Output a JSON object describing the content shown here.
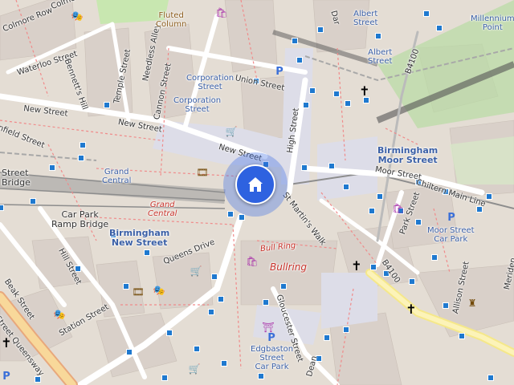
{
  "map": {
    "streets": [
      {
        "id": "colmore-row",
        "text": "Colmore Row",
        "color": "dark"
      },
      {
        "id": "colmore",
        "text": "Colmo",
        "color": "dark"
      },
      {
        "id": "waterloo",
        "text": "Waterloo Street",
        "color": "dark"
      },
      {
        "id": "bennetts",
        "text": "Bennett's Hill",
        "color": "dark"
      },
      {
        "id": "temple",
        "text": "Temple Street",
        "color": "dark"
      },
      {
        "id": "needless",
        "text": "Needless Alley",
        "color": "dark"
      },
      {
        "id": "cannon",
        "text": "Cannon Street",
        "color": "dark"
      },
      {
        "id": "new-street-1",
        "text": "New Street",
        "color": "dark"
      },
      {
        "id": "new-street-2",
        "text": "New Street",
        "color": "dark"
      },
      {
        "id": "new-street-3",
        "text": "New Street",
        "color": "dark"
      },
      {
        "id": "union",
        "text": "Union Street",
        "color": "dark"
      },
      {
        "id": "high",
        "text": "High Street",
        "color": "dark"
      },
      {
        "id": "stmartins",
        "text": "St Martin's Walk",
        "color": "dark"
      },
      {
        "id": "moor",
        "text": "Moor Street",
        "color": "dark"
      },
      {
        "id": "park",
        "text": "Park Street",
        "color": "dark"
      },
      {
        "id": "queens",
        "text": "Queens Drive",
        "color": "dark"
      },
      {
        "id": "hill",
        "text": "Hill Street",
        "color": "dark"
      },
      {
        "id": "beak",
        "text": "Beak Street",
        "color": "dark"
      },
      {
        "id": "station",
        "text": "Station Street",
        "color": "dark"
      },
      {
        "id": "gloucester",
        "text": "Gloucester Street",
        "color": "dark"
      },
      {
        "id": "allison",
        "text": "Allison Street",
        "color": "dark"
      },
      {
        "id": "meriden",
        "text": "Meriden",
        "color": "dark"
      },
      {
        "id": "smallbrook",
        "text": "Street Queensway",
        "color": "dark"
      },
      {
        "id": "chiltern",
        "text": "Chiltern Main Line",
        "color": "dark"
      },
      {
        "id": "nfield",
        "text": "nfield Street",
        "color": "dark"
      },
      {
        "id": "dean",
        "text": "Dean",
        "color": "dark"
      },
      {
        "id": "dar",
        "text": "Dar",
        "color": "dark"
      },
      {
        "id": "b4100a",
        "text": "B4100",
        "color": "dark"
      },
      {
        "id": "b4100b",
        "text": "B4100",
        "color": "dark"
      }
    ],
    "places": [
      {
        "id": "albert-street-1",
        "text": "Albert\nStreet"
      },
      {
        "id": "albert-street-2",
        "text": "Albert\nStreet"
      },
      {
        "id": "corporation-1",
        "text": "Corporation\nStreet"
      },
      {
        "id": "corporation-2",
        "text": "Corporation\nStreet"
      },
      {
        "id": "grand-central",
        "text": "Grand\nCentral"
      },
      {
        "id": "car-park-ramp",
        "text": "Car Park\nRamp Bridge"
      },
      {
        "id": "moor-car-park",
        "text": "Moor Street\nCar Park"
      },
      {
        "id": "edgbaston",
        "text": "Edgbaston\nStreet\nCar Park"
      },
      {
        "id": "millennium",
        "text": "Millennium\nPoint"
      },
      {
        "id": "fluted",
        "text": "Fluted\nColumn"
      },
      {
        "id": "street-bridge",
        "text": "Street\nBridge"
      }
    ],
    "stations": [
      {
        "id": "bham-new-street",
        "text": "Birmingham\nNew Street"
      },
      {
        "id": "bham-moor-street",
        "text": "Birmingham\nMoor Street"
      }
    ],
    "red_labels": [
      {
        "id": "grand-central-red",
        "text": "Grand\nCentral"
      },
      {
        "id": "bull-ring-small",
        "text": "Bull Ring"
      },
      {
        "id": "bullring-big",
        "text": "Bullring"
      }
    ],
    "icons": [
      {
        "name": "theatre-icon",
        "glyph": "🎭",
        "color": "brown"
      },
      {
        "name": "shop-bag-icon",
        "glyph": "🛍",
        "color": "purple"
      },
      {
        "name": "shop-bag-icon-2",
        "glyph": "🛍",
        "color": "purple"
      },
      {
        "name": "shop-bag-icon-3",
        "glyph": "🛍",
        "color": "purple"
      },
      {
        "name": "cart-icon",
        "glyph": "🛒",
        "color": "purple"
      },
      {
        "name": "cart-icon-2",
        "glyph": "🛒",
        "color": "purple"
      },
      {
        "name": "cart-icon-3",
        "glyph": "🛒",
        "color": "purple"
      },
      {
        "name": "cinema-icon",
        "glyph": "🎞",
        "color": "brown"
      },
      {
        "name": "cinema-icon-2",
        "glyph": "🎞",
        "color": "brown"
      },
      {
        "name": "theatre-icon-2",
        "glyph": "🎭",
        "color": "brown"
      },
      {
        "name": "theatre-icon-3",
        "glyph": "🎭",
        "color": "brown"
      },
      {
        "name": "church-icon",
        "glyph": "✝",
        "color": "black"
      },
      {
        "name": "church-icon-2",
        "glyph": "✝",
        "color": "black"
      },
      {
        "name": "church-icon-3",
        "glyph": "✝",
        "color": "black"
      },
      {
        "name": "church-icon-4",
        "glyph": "✝",
        "color": "black"
      },
      {
        "name": "parking-icon",
        "glyph": "P",
        "color": "blue"
      },
      {
        "name": "parking-icon-2",
        "glyph": "P",
        "color": "blue"
      },
      {
        "name": "parking-icon-3",
        "glyph": "P",
        "color": "blue"
      },
      {
        "name": "parking-icon-4",
        "glyph": "P",
        "color": "blue"
      },
      {
        "name": "market-icon",
        "glyph": "⛩",
        "color": "purple"
      },
      {
        "name": "statue-icon",
        "glyph": "♜",
        "color": "brown"
      }
    ],
    "location_button": {
      "name": "home-location-icon",
      "color": "#2e62e0",
      "halo": "#3c6ee6"
    },
    "colors": {
      "land": "#e4ddd4",
      "building": "#d9d0c9",
      "pedestrian": "#dddde8",
      "road": "#ffffff",
      "primary": "#f8d89a",
      "rail": "#888888",
      "water_green": "#c8e7b0",
      "bus_stop": "#1f79cf",
      "red_path": "#f08a8a"
    }
  }
}
